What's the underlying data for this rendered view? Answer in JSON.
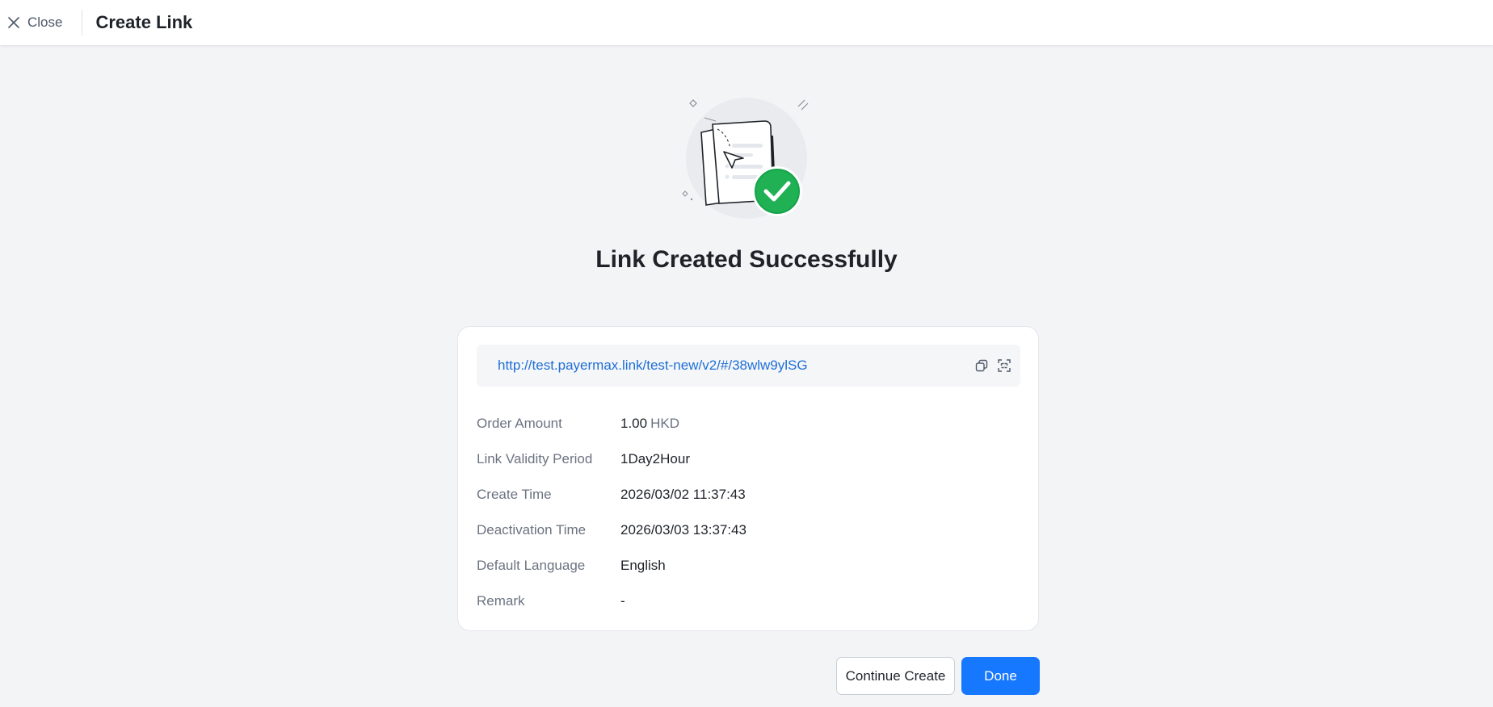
{
  "header": {
    "close_label": "Close",
    "title": "Create Link"
  },
  "result": {
    "title": "Link Created Successfully",
    "link_url": "http://test.payermax.link/test-new/v2/#/38wlw9ylSG"
  },
  "details": {
    "order_amount": {
      "label": "Order Amount",
      "value": "1.00",
      "currency": "HKD"
    },
    "validity": {
      "label": "Link Validity Period",
      "value": "1Day2Hour"
    },
    "create_time": {
      "label": "Create Time",
      "value": "2026/03/02 11:37:43"
    },
    "deactivation_time": {
      "label": "Deactivation Time",
      "value": "2026/03/03 13:37:43"
    },
    "language": {
      "label": "Default Language",
      "value": "English"
    },
    "remark": {
      "label": "Remark",
      "value": "-"
    }
  },
  "actions": {
    "continue_label": "Continue Create",
    "done_label": "Done"
  },
  "icons": {
    "close": "close-icon",
    "copy": "copy-icon",
    "qr": "qr-code-icon",
    "success": "check-circle-icon"
  },
  "colors": {
    "primary": "#1677ff",
    "link": "#1f6fd8",
    "success": "#20b155",
    "background": "#f3f4f6"
  }
}
